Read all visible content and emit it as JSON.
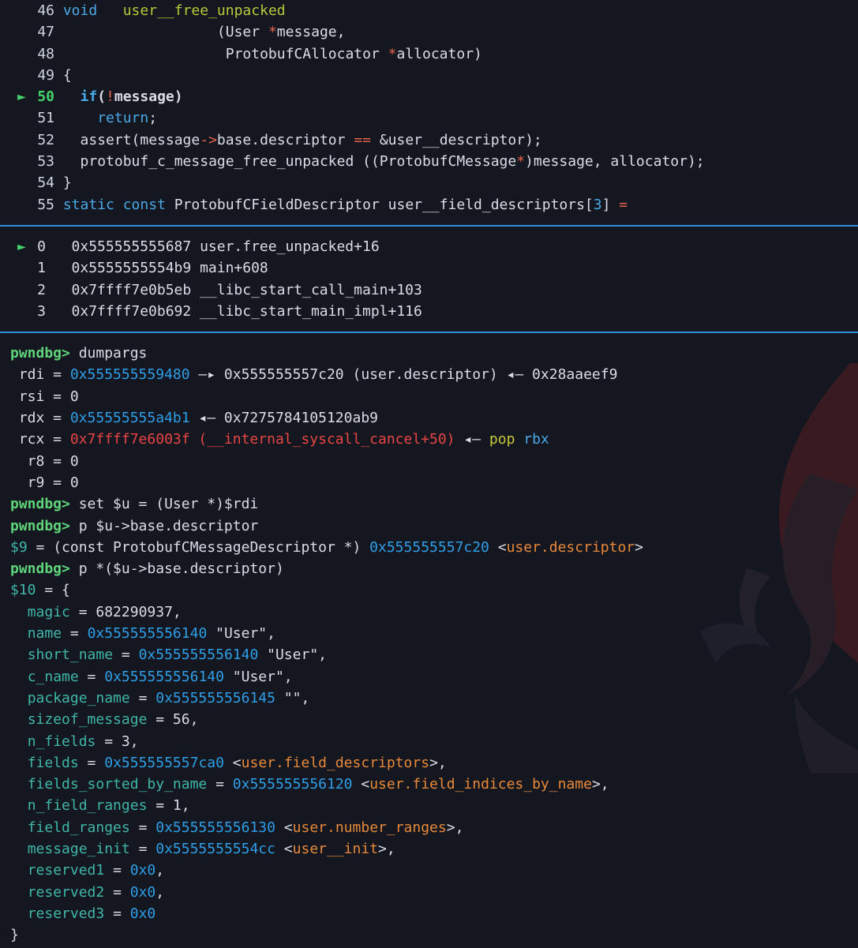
{
  "source": {
    "lines": [
      {
        "n": "46",
        "parts": [
          [
            "kw",
            "void"
          ],
          [
            "t",
            "   "
          ],
          [
            "fn",
            "user__free_unpacked"
          ]
        ]
      },
      {
        "n": "47",
        "parts": [
          [
            "t",
            "                  (User "
          ],
          [
            "op",
            "*"
          ],
          [
            "t",
            "message,"
          ]
        ]
      },
      {
        "n": "48",
        "parts": [
          [
            "t",
            "                   ProtobufCAllocator "
          ],
          [
            "op",
            "*"
          ],
          [
            "t",
            "allocator)"
          ]
        ]
      },
      {
        "n": "49",
        "parts": [
          [
            "t",
            "{"
          ]
        ]
      },
      {
        "n": "50",
        "current": true,
        "parts": [
          [
            "t",
            "  "
          ],
          [
            "kw",
            "if"
          ],
          [
            "t",
            "("
          ],
          [
            "op",
            "!"
          ],
          [
            "t",
            "message)"
          ]
        ]
      },
      {
        "n": "51",
        "parts": [
          [
            "t",
            "    "
          ],
          [
            "kw",
            "return"
          ],
          [
            "t",
            ";"
          ]
        ]
      },
      {
        "n": "52",
        "parts": [
          [
            "t",
            "  assert(message"
          ],
          [
            "op",
            "->"
          ],
          [
            "t",
            "base.descriptor "
          ],
          [
            "op",
            "=="
          ],
          [
            "t",
            " &user__descriptor);"
          ]
        ]
      },
      {
        "n": "53",
        "parts": [
          [
            "t",
            "  protobuf_c_message_free_unpacked ((ProtobufCMessage"
          ],
          [
            "op",
            "*"
          ],
          [
            "t",
            ")message, allocator);"
          ]
        ]
      },
      {
        "n": "54",
        "parts": [
          [
            "t",
            "}"
          ]
        ]
      },
      {
        "n": "55",
        "parts": [
          [
            "kw",
            "static"
          ],
          [
            "t",
            " "
          ],
          [
            "kw",
            "const"
          ],
          [
            "t",
            " ProtobufCFieldDescriptor user__field_descriptors["
          ],
          [
            "blue",
            "3"
          ],
          [
            "t",
            "] "
          ],
          [
            "op",
            "="
          ]
        ]
      }
    ],
    "marker": "►"
  },
  "backtrace": {
    "marker": "►",
    "frames": [
      {
        "idx": "0",
        "addr": "0x555555555687",
        "sym": "user.free_unpacked+16",
        "current": true
      },
      {
        "idx": "1",
        "addr": "0x5555555554b9",
        "sym": "main+608"
      },
      {
        "idx": "2",
        "addr": "0x7ffff7e0b5eb",
        "sym": "__libc_start_call_main+103"
      },
      {
        "idx": "3",
        "addr": "0x7ffff7e0b692",
        "sym": "__libc_start_main_impl+116"
      }
    ]
  },
  "console": {
    "lines": [
      [
        [
          "prompt",
          "pwndbg>"
        ],
        [
          "t",
          " dumpargs"
        ]
      ],
      [
        [
          "t",
          " rdi = "
        ],
        [
          "addr",
          "0x555555559480"
        ],
        [
          "t",
          " —▸ 0x555555557c20 (user.descriptor) ◂— 0x28aaeef9"
        ]
      ],
      [
        [
          "t",
          " rsi = 0"
        ]
      ],
      [
        [
          "t",
          " rdx = "
        ],
        [
          "addr",
          "0x55555555a4b1"
        ],
        [
          "t",
          " ◂— 0x7275784105120ab9"
        ]
      ],
      [
        [
          "t",
          " rcx = "
        ],
        [
          "red",
          "0x7ffff7e6003f (__internal_syscall_cancel+50)"
        ],
        [
          "t",
          " ◂— "
        ],
        [
          "yellow",
          "pop"
        ],
        [
          "t",
          " "
        ],
        [
          "blue",
          "rbx"
        ]
      ],
      [
        [
          "t",
          "  r8 = 0"
        ]
      ],
      [
        [
          "t",
          "  r9 = 0"
        ]
      ],
      [
        [
          "prompt",
          "pwndbg>"
        ],
        [
          "t",
          " set $u = (User *)$rdi"
        ]
      ],
      [
        [
          "prompt",
          "pwndbg>"
        ],
        [
          "t",
          " p $u->base.descriptor"
        ]
      ],
      [
        [
          "field",
          "$9"
        ],
        [
          "t",
          " = (const ProtobufCMessageDescriptor *) "
        ],
        [
          "addr",
          "0x555555557c20"
        ],
        [
          "t",
          " <"
        ],
        [
          "sym",
          "user.descriptor"
        ],
        [
          "t",
          ">"
        ]
      ],
      [
        [
          "prompt",
          "pwndbg>"
        ],
        [
          "t",
          " p *($u->base.descriptor)"
        ]
      ],
      [
        [
          "field",
          "$10"
        ],
        [
          "t",
          " = {"
        ]
      ],
      [
        [
          "t",
          "  "
        ],
        [
          "field",
          "magic"
        ],
        [
          "t",
          " = 682290937,"
        ]
      ],
      [
        [
          "t",
          "  "
        ],
        [
          "field",
          "name"
        ],
        [
          "t",
          " = "
        ],
        [
          "addr",
          "0x555555556140"
        ],
        [
          "t",
          " \"User\","
        ]
      ],
      [
        [
          "t",
          "  "
        ],
        [
          "field",
          "short_name"
        ],
        [
          "t",
          " = "
        ],
        [
          "addr",
          "0x555555556140"
        ],
        [
          "t",
          " \"User\","
        ]
      ],
      [
        [
          "t",
          "  "
        ],
        [
          "field",
          "c_name"
        ],
        [
          "t",
          " = "
        ],
        [
          "addr",
          "0x555555556140"
        ],
        [
          "t",
          " \"User\","
        ]
      ],
      [
        [
          "t",
          "  "
        ],
        [
          "field",
          "package_name"
        ],
        [
          "t",
          " = "
        ],
        [
          "addr",
          "0x555555556145"
        ],
        [
          "t",
          " \"\","
        ]
      ],
      [
        [
          "t",
          "  "
        ],
        [
          "field",
          "sizeof_message"
        ],
        [
          "t",
          " = 56,"
        ]
      ],
      [
        [
          "t",
          "  "
        ],
        [
          "field",
          "n_fields"
        ],
        [
          "t",
          " = 3,"
        ]
      ],
      [
        [
          "t",
          "  "
        ],
        [
          "field",
          "fields"
        ],
        [
          "t",
          " = "
        ],
        [
          "addr",
          "0x555555557ca0"
        ],
        [
          "t",
          " <"
        ],
        [
          "sym",
          "user.field_descriptors"
        ],
        [
          "t",
          ">,"
        ]
      ],
      [
        [
          "t",
          "  "
        ],
        [
          "field",
          "fields_sorted_by_name"
        ],
        [
          "t",
          " = "
        ],
        [
          "addr",
          "0x555555556120"
        ],
        [
          "t",
          " <"
        ],
        [
          "sym",
          "user.field_indices_by_name"
        ],
        [
          "t",
          ">,"
        ]
      ],
      [
        [
          "t",
          "  "
        ],
        [
          "field",
          "n_field_ranges"
        ],
        [
          "t",
          " = 1,"
        ]
      ],
      [
        [
          "t",
          "  "
        ],
        [
          "field",
          "field_ranges"
        ],
        [
          "t",
          " = "
        ],
        [
          "addr",
          "0x555555556130"
        ],
        [
          "t",
          " <"
        ],
        [
          "sym",
          "user.number_ranges"
        ],
        [
          "t",
          ">,"
        ]
      ],
      [
        [
          "t",
          "  "
        ],
        [
          "field",
          "message_init"
        ],
        [
          "t",
          " = "
        ],
        [
          "addr",
          "0x5555555554cc"
        ],
        [
          "t",
          " <"
        ],
        [
          "sym",
          "user__init"
        ],
        [
          "t",
          ">,"
        ]
      ],
      [
        [
          "t",
          "  "
        ],
        [
          "field",
          "reserved1"
        ],
        [
          "t",
          " = "
        ],
        [
          "addr",
          "0x0"
        ],
        [
          "t",
          ","
        ]
      ],
      [
        [
          "t",
          "  "
        ],
        [
          "field",
          "reserved2"
        ],
        [
          "t",
          " = "
        ],
        [
          "addr",
          "0x0"
        ],
        [
          "t",
          ","
        ]
      ],
      [
        [
          "t",
          "  "
        ],
        [
          "field",
          "reserved3"
        ],
        [
          "t",
          " = "
        ],
        [
          "addr",
          "0x0"
        ]
      ],
      [
        [
          "t",
          "}"
        ]
      ]
    ]
  },
  "colors": {
    "background": "#14171f",
    "separator": "#2f8fd4",
    "prompt": "#5fd37a",
    "address": "#2f9ee8",
    "symbol": "#e8893a",
    "field": "#3fb6a8"
  }
}
